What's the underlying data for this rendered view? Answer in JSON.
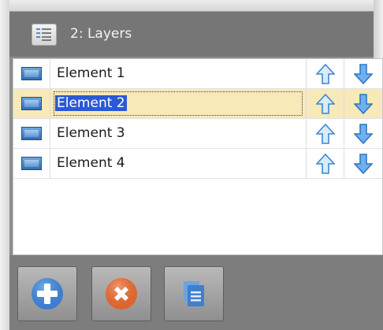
{
  "panel": {
    "title": "2: Layers",
    "title_icon": "list-icon"
  },
  "layers": [
    {
      "name": "Element 1",
      "selected": false,
      "icon": "image-icon"
    },
    {
      "name": "Element 2",
      "selected": true,
      "icon": "image-icon"
    },
    {
      "name": "Element 3",
      "selected": false,
      "icon": "image-icon"
    },
    {
      "name": "Element 4",
      "selected": false,
      "icon": "image-icon"
    }
  ],
  "row_actions": {
    "up_icon": "arrow-up-icon",
    "down_icon": "arrow-down-icon"
  },
  "toolbar": {
    "buttons": [
      {
        "icon": "add-icon",
        "color": "#3f7fd0"
      },
      {
        "icon": "remove-icon",
        "color": "#e1672f"
      },
      {
        "icon": "duplicate-icon",
        "color": "#3f7fd0"
      }
    ]
  },
  "colors": {
    "selected_row": "#f7e9b8",
    "selection_highlight": "#2a59d6",
    "arrow": "#5aa0e6"
  }
}
